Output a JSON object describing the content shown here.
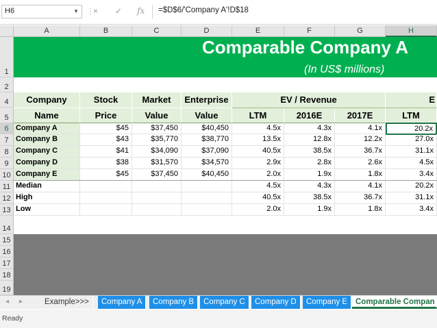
{
  "formula_bar": {
    "name_box": "H6",
    "cancel_icon": "×",
    "enter_icon": "✓",
    "fx_icon": "fx",
    "formula": "=$D$6/'Company A'!D$18"
  },
  "columns": [
    "A",
    "B",
    "C",
    "D",
    "E",
    "F",
    "G",
    "H"
  ],
  "rows": [
    "1",
    "2",
    "4",
    "5",
    "6",
    "7",
    "8",
    "9",
    "10",
    "11",
    "12",
    "13",
    "14",
    "15",
    "16",
    "17",
    "18",
    "19"
  ],
  "title": {
    "main": "Comparable Company A",
    "sub": "(In US$ millions)"
  },
  "headers": {
    "company_top": "Company",
    "company_bottom": "Name",
    "stock_top": "Stock",
    "stock_bottom": "Price",
    "market_top": "Market",
    "market_bottom": "Value",
    "enterprise_top": "Enterprise",
    "enterprise_bottom": "Value",
    "ev_revenue": "EV / Revenue",
    "ev_ebitda_partial": "E",
    "ltm": "LTM",
    "y2016": "2016E",
    "y2017": "2017E",
    "ltm2": "LTM"
  },
  "companies": [
    {
      "name": "Company A",
      "price": "$45",
      "market": "$37,450",
      "ev": "$40,450",
      "ltm": "4.5x",
      "y2016": "4.3x",
      "y2017": "4.1x",
      "h": "20.2x"
    },
    {
      "name": "Company B",
      "price": "$43",
      "market": "$35,770",
      "ev": "$38,770",
      "ltm": "13.5x",
      "y2016": "12.8x",
      "y2017": "12.2x",
      "h": "27.0x"
    },
    {
      "name": "Company C",
      "price": "$41",
      "market": "$34,090",
      "ev": "$37,090",
      "ltm": "40.5x",
      "y2016": "38.5x",
      "y2017": "36.7x",
      "h": "31.1x"
    },
    {
      "name": "Company D",
      "price": "$38",
      "market": "$31,570",
      "ev": "$34,570",
      "ltm": "2.9x",
      "y2016": "2.8x",
      "y2017": "2.6x",
      "h": "4.5x"
    },
    {
      "name": "Company E",
      "price": "$45",
      "market": "$37,450",
      "ev": "$40,450",
      "ltm": "2.0x",
      "y2016": "1.9x",
      "y2017": "1.8x",
      "h": "3.4x"
    }
  ],
  "stats": [
    {
      "name": "Median",
      "ltm": "4.5x",
      "y2016": "4.3x",
      "y2017": "4.1x",
      "h": "20.2x"
    },
    {
      "name": "High",
      "ltm": "40.5x",
      "y2016": "38.5x",
      "y2017": "36.7x",
      "h": "31.1x"
    },
    {
      "name": "Low",
      "ltm": "2.0x",
      "y2016": "1.9x",
      "y2017": "1.8x",
      "h": "3.4x"
    }
  ],
  "sheet_tabs": {
    "prev": "◂",
    "next": "▸",
    "items": [
      "Example>>>",
      "Company A",
      "Company B",
      "Company C",
      "Company D",
      "Company E",
      "Comparable Compan"
    ]
  },
  "status_bar": {
    "text": "Ready"
  },
  "colors": {
    "banner": "#00b050",
    "header_fill": "#e2efda",
    "tab_blue": "#1e8fe8",
    "excel_green": "#217346",
    "gray_block": "#7a7a7a"
  }
}
